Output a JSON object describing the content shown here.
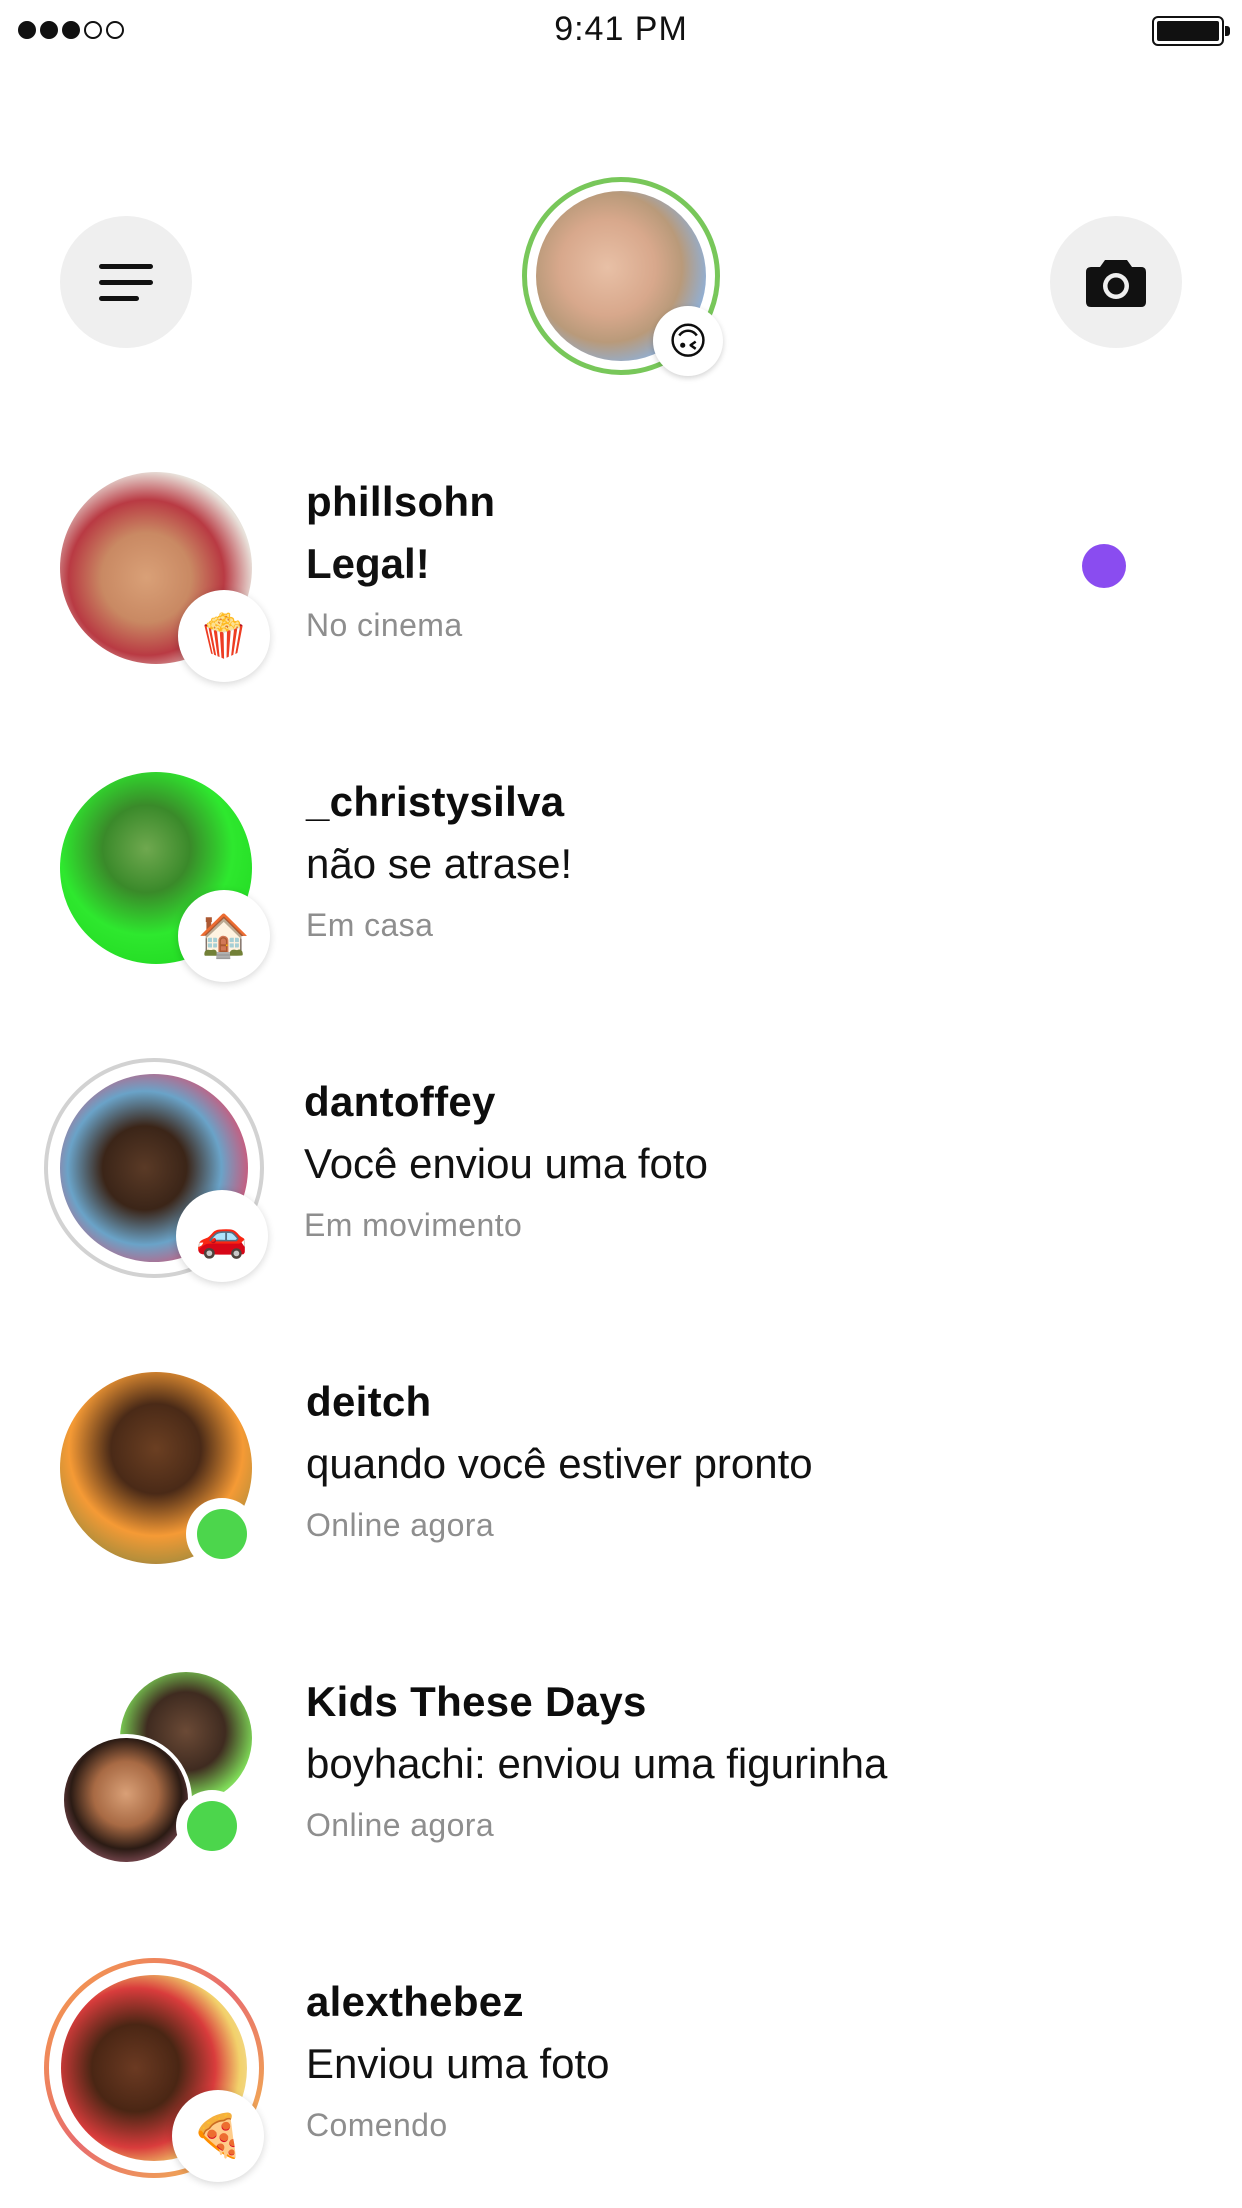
{
  "status_bar": {
    "signal_dots_filled": 3,
    "signal_dots_total": 5,
    "time": "9:41 PM",
    "battery_level": 1.0
  },
  "header": {
    "menu_icon": "hamburger-menu-icon",
    "camera_icon": "camera-icon",
    "self_status_emoji": "🙃",
    "self_ring_color": "#78c75a"
  },
  "conversations": [
    {
      "name": "phillsohn",
      "message": "Legal!",
      "status": "No cinema",
      "status_emoji": "🍿",
      "unread": true,
      "unread_color": "#8a4cf0"
    },
    {
      "name": "_christysilva",
      "message": "não se atrase!",
      "status": "Em casa",
      "status_emoji": "🏠",
      "unread": false
    },
    {
      "name": "dantoffey",
      "message": "Você enviou uma foto",
      "status": "Em movimento",
      "status_emoji": "🚗",
      "unread": false
    },
    {
      "name": "deitch",
      "message": "quando você estiver pronto",
      "status": "Online agora",
      "online": true,
      "unread": false
    },
    {
      "name": "Kids These Days",
      "message": "boyhachi: enviou uma figurinha",
      "status": "Online agora",
      "online": true,
      "unread": false
    },
    {
      "name": "alexthebez",
      "message": "Enviou uma foto",
      "status": "Comendo",
      "status_emoji": "🍕",
      "unread": false
    }
  ],
  "colors": {
    "online_green": "#4cd64c",
    "secondary_text": "#8e8e8e",
    "button_bg": "#efefef"
  }
}
